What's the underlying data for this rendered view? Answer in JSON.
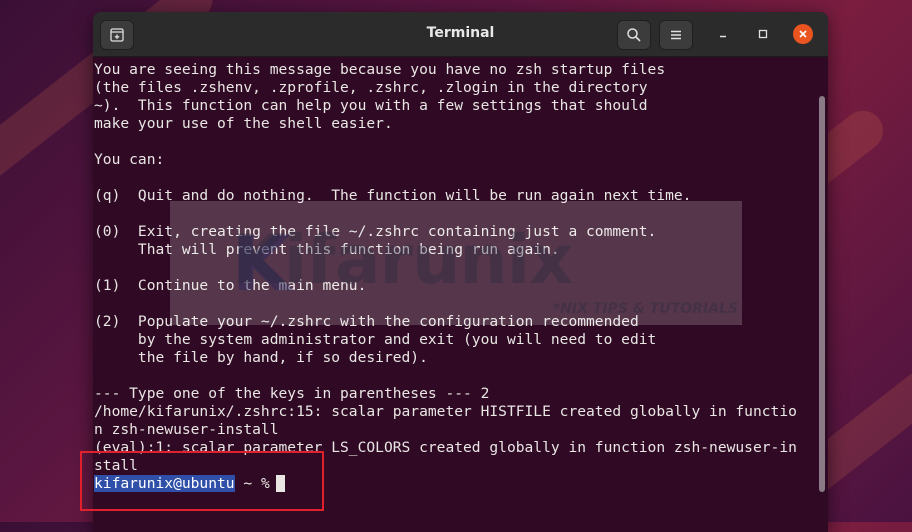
{
  "window": {
    "title": "Terminal",
    "new_tab_icon": "new-tab-icon",
    "search_icon": "search-icon",
    "menu_icon": "hamburger-menu-icon"
  },
  "terminal": {
    "lines": [
      "You are seeing this message because you have no zsh startup files",
      "(the files .zshenv, .zprofile, .zshrc, .zlogin in the directory",
      "~).  This function can help you with a few settings that should",
      "make your use of the shell easier.",
      "",
      "You can:",
      "",
      "(q)  Quit and do nothing.  The function will be run again next time.",
      "",
      "(0)  Exit, creating the file ~/.zshrc containing just a comment.",
      "     That will prevent this function being run again.",
      "",
      "(1)  Continue to the main menu.",
      "",
      "(2)  Populate your ~/.zshrc with the configuration recommended",
      "     by the system administrator and exit (you will need to edit",
      "     the file by hand, if so desired).",
      "",
      "--- Type one of the keys in parentheses --- 2",
      "/home/kifarunix/.zshrc:15: scalar parameter HISTFILE created globally in functio",
      "n zsh-newuser-install",
      "(eval):1: scalar parameter LS_COLORS created globally in function zsh-newuser-in",
      "stall"
    ],
    "prompt_user": "kifarunix@ubuntu",
    "prompt_rest": " ~ %"
  },
  "watermark": {
    "name": "Kifarunix",
    "tagline": "*NIX TIPS & TUTORIALS"
  },
  "colors": {
    "terminal_bg": "#300a24",
    "titlebar_bg": "#2b2b2b",
    "close_button": "#e95420",
    "highlight": "#e0202a"
  }
}
